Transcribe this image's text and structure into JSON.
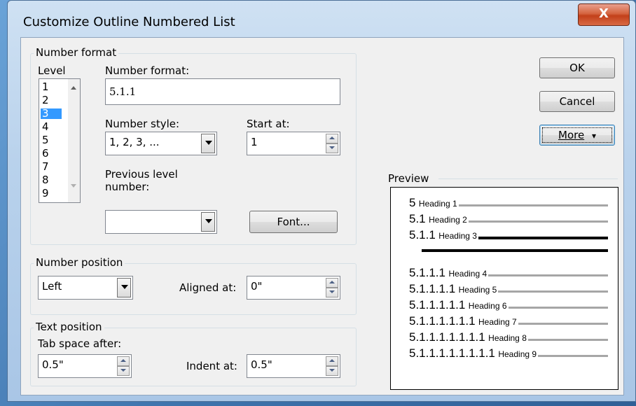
{
  "window": {
    "title": "Customize Outline Numbered List",
    "close_glyph": "X"
  },
  "number_format_group": {
    "label": "Number format",
    "level_label": "Level",
    "levels": [
      "1",
      "2",
      "3",
      "4",
      "5",
      "6",
      "7",
      "8",
      "9"
    ],
    "selected_level": "3",
    "number_format_label": "Number format:",
    "number_format_value": "5.1.1",
    "number_style_label": "Number style:",
    "number_style_value": "1, 2, 3, ...",
    "start_at_label": "Start at:",
    "start_at_value": "1",
    "previous_level_label_1": "Previous level",
    "previous_level_label_2": "number:",
    "previous_level_value": "",
    "font_button": "Font..."
  },
  "number_position_group": {
    "label": "Number position",
    "alignment_value": "Left",
    "aligned_at_label": "Aligned at:",
    "aligned_at_value": "0\""
  },
  "text_position_group": {
    "label": "Text position",
    "tab_space_label": "Tab space after:",
    "tab_space_value": "0.5\"",
    "indent_at_label": "Indent at:",
    "indent_at_value": "0.5\""
  },
  "buttons": {
    "ok": "OK",
    "cancel": "Cancel",
    "more": "More",
    "more_glyph": "↕"
  },
  "preview": {
    "label": "Preview",
    "lines": [
      {
        "num": "5",
        "heading": "Heading 1"
      },
      {
        "num": "5.1",
        "heading": "Heading 2"
      },
      {
        "num": "5.1.1",
        "heading": "Heading 3"
      },
      {
        "num": "5.1.1.1",
        "heading": "Heading 4"
      },
      {
        "num": "5.1.1.1.1",
        "heading": "Heading 5"
      },
      {
        "num": "5.1.1.1.1.1",
        "heading": "Heading 6"
      },
      {
        "num": "5.1.1.1.1.1.1",
        "heading": "Heading 7"
      },
      {
        "num": "5.1.1.1.1.1.1.1",
        "heading": "Heading 8"
      },
      {
        "num": "5.1.1.1.1.1.1.1.1",
        "heading": "Heading 9"
      }
    ]
  },
  "colors": {
    "selection": "#3399ff",
    "close_button": "#c2401a",
    "title_bar": "#b9d2ec"
  }
}
